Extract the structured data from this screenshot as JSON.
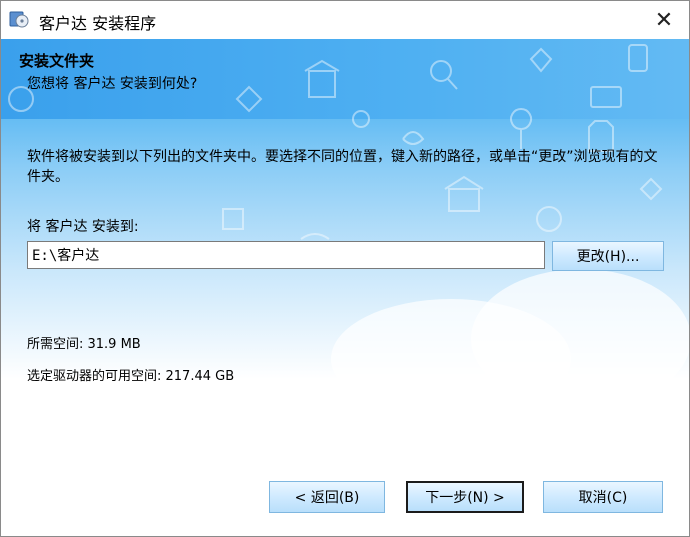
{
  "window": {
    "title": "客户达 安装程序"
  },
  "header": {
    "title": "安装文件夹",
    "subtitle": "您想将 客户达 安装到何处?"
  },
  "body": {
    "description": "软件将被安装到以下列出的文件夹中。要选择不同的位置，键入新的路径，或单击“更改”浏览现有的文件夹。",
    "install_label": "将 客户达 安装到:",
    "path_value": "E:\\客户达",
    "change_button": "更改(H)...",
    "space_required": "所需空间: 31.9 MB",
    "space_available": "选定驱动器的可用空间: 217.44 GB"
  },
  "footer": {
    "back_button": "< 返回(B)",
    "next_button": "下一步(N) >",
    "cancel_button": "取消(C)"
  },
  "icons": {
    "app": "installer-disc-icon",
    "close": "close-icon"
  },
  "colors": {
    "header_blue": "#3aa6ee",
    "button_blue": "#cfeaff"
  }
}
